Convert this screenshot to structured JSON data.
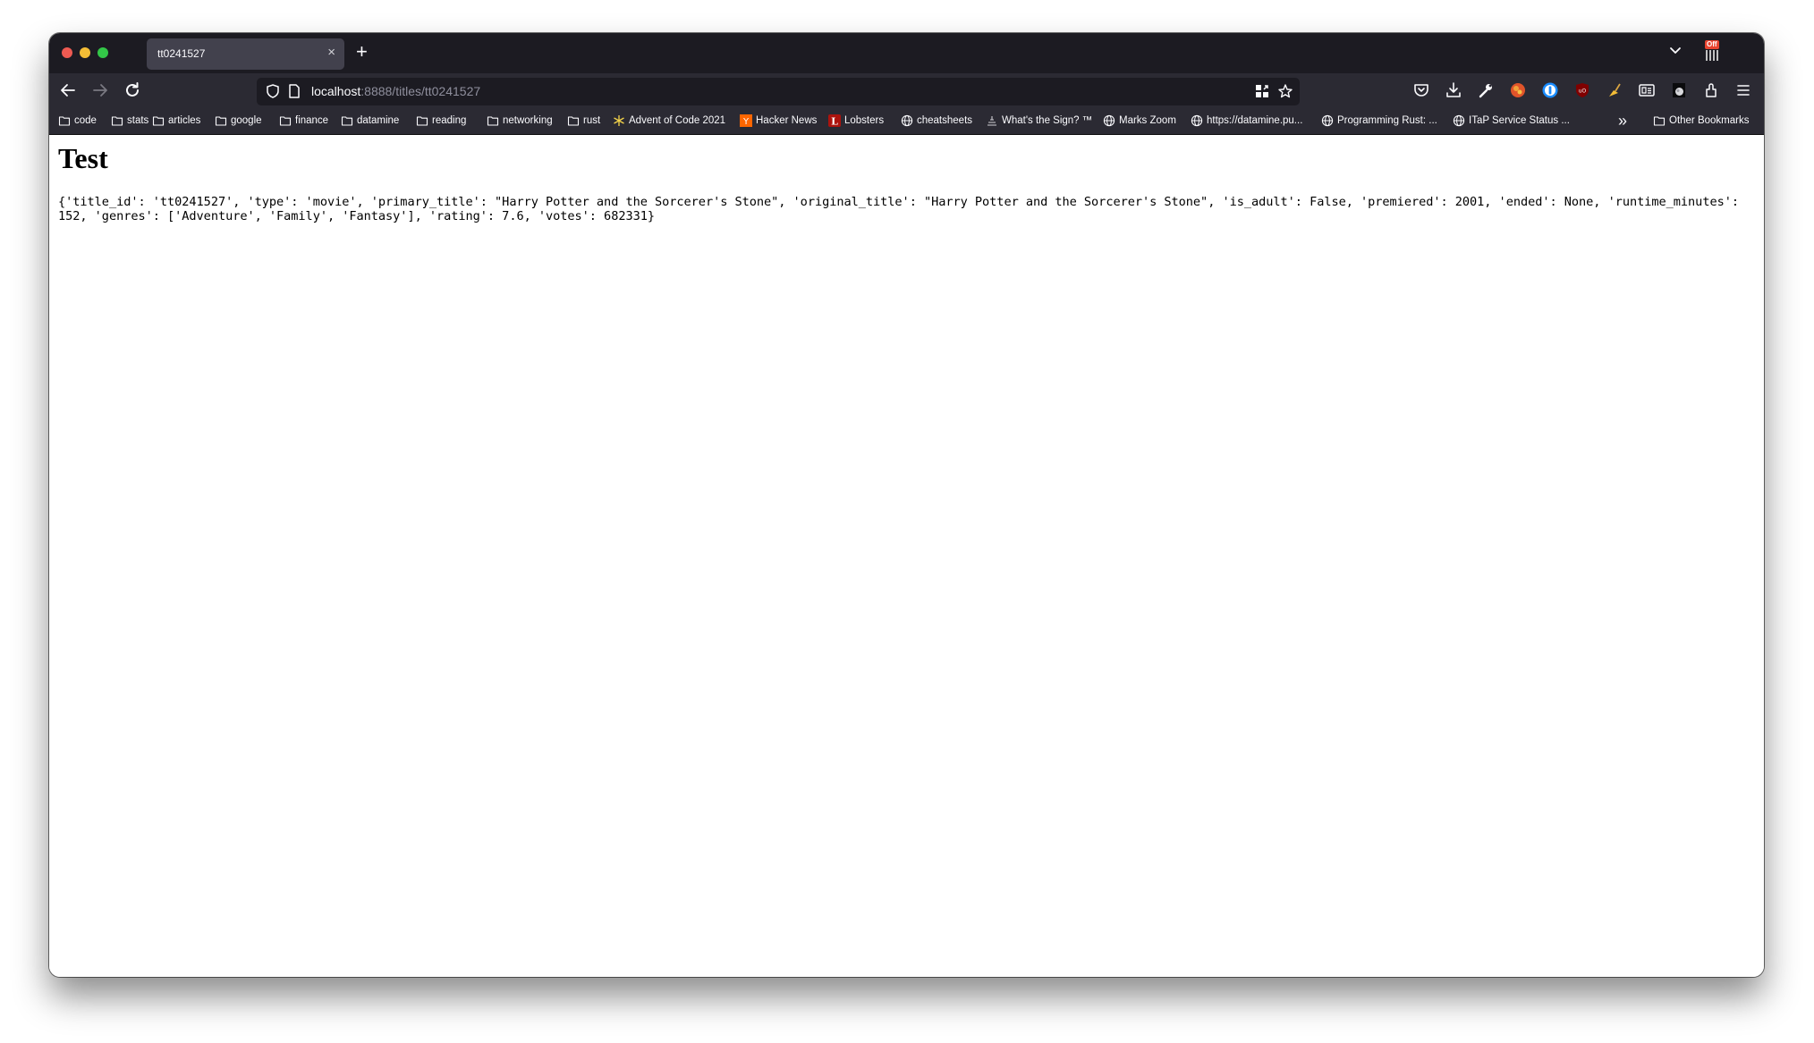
{
  "window": {
    "traffic_lights": [
      "close",
      "minimize",
      "zoom"
    ]
  },
  "tabs": [
    {
      "title": "tt0241527",
      "active": true,
      "close_glyph": "×"
    }
  ],
  "tabbar": {
    "new_tab_glyph": "+",
    "list_tabs_icon": "chevron-down-icon",
    "extension_badge": "Off"
  },
  "toolbar": {
    "back_icon": "arrow-left-icon",
    "forward_icon": "arrow-right-icon",
    "reload_icon": "reload-icon",
    "url": {
      "host": "localhost",
      "path": ":8888/titles/tt0241527"
    },
    "right_icons": [
      "pocket-icon",
      "download-icon",
      "wrench-icon",
      "extension-fox-icon",
      "1password-icon",
      "ublock-icon",
      "extension-broom-icon",
      "reader-icon",
      "extension-dark-icon",
      "extensions-puzzle-icon",
      "hamburger-menu-icon"
    ]
  },
  "bookmarks": [
    {
      "label": "code",
      "icon": "folder"
    },
    {
      "label": "stats",
      "icon": "folder"
    },
    {
      "label": "articles",
      "icon": "folder"
    },
    {
      "label": "google",
      "icon": "folder"
    },
    {
      "label": "finance",
      "icon": "folder"
    },
    {
      "label": "datamine",
      "icon": "folder"
    },
    {
      "label": "reading",
      "icon": "folder"
    },
    {
      "label": "networking",
      "icon": "folder"
    },
    {
      "label": "rust",
      "icon": "folder"
    },
    {
      "label": "Advent of Code 2021",
      "icon": "star"
    },
    {
      "label": "Hacker News",
      "icon": "hn"
    },
    {
      "label": "Lobsters",
      "icon": "lobsters"
    },
    {
      "label": "cheatsheets",
      "icon": "globe"
    },
    {
      "label": "What's the Sign? ™",
      "icon": "sign"
    },
    {
      "label": "Marks Zoom",
      "icon": "globe"
    },
    {
      "label": "https://datamine.pu...",
      "icon": "globe"
    },
    {
      "label": "Programming Rust: ...",
      "icon": "globe"
    },
    {
      "label": "ITaP Service Status ...",
      "icon": "globe"
    }
  ],
  "bookmarks_overflow_glyph": "»",
  "other_bookmarks": "Other Bookmarks",
  "page": {
    "heading": "Test",
    "payload": "{'title_id': 'tt0241527', 'type': 'movie', 'primary_title': \"Harry Potter and the Sorcerer's Stone\", 'original_title': \"Harry Potter and the Sorcerer's Stone\", 'is_adult': False, 'premiered': 2001, 'ended': None, 'runtime_minutes': 152, 'genres': ['Adventure', 'Family', 'Fantasy'], 'rating': 7.6, 'votes': 682331}",
    "record": {
      "title_id": "tt0241527",
      "type": "movie",
      "primary_title": "Harry Potter and the Sorcerer's Stone",
      "original_title": "Harry Potter and the Sorcerer's Stone",
      "is_adult": "False",
      "premiered": 2001,
      "ended": "None",
      "runtime_minutes": 152,
      "genres": [
        "Adventure",
        "Family",
        "Fantasy"
      ],
      "rating": 7.6,
      "votes": 682331
    }
  },
  "colors": {
    "tabbar_bg": "#1c1b22",
    "toolbar_bg": "#2b2a33",
    "active_tab_bg": "#42414d",
    "url_path": "#8f8f9d",
    "hn_orange": "#ff6600",
    "lobsters_red": "#ac130d"
  }
}
